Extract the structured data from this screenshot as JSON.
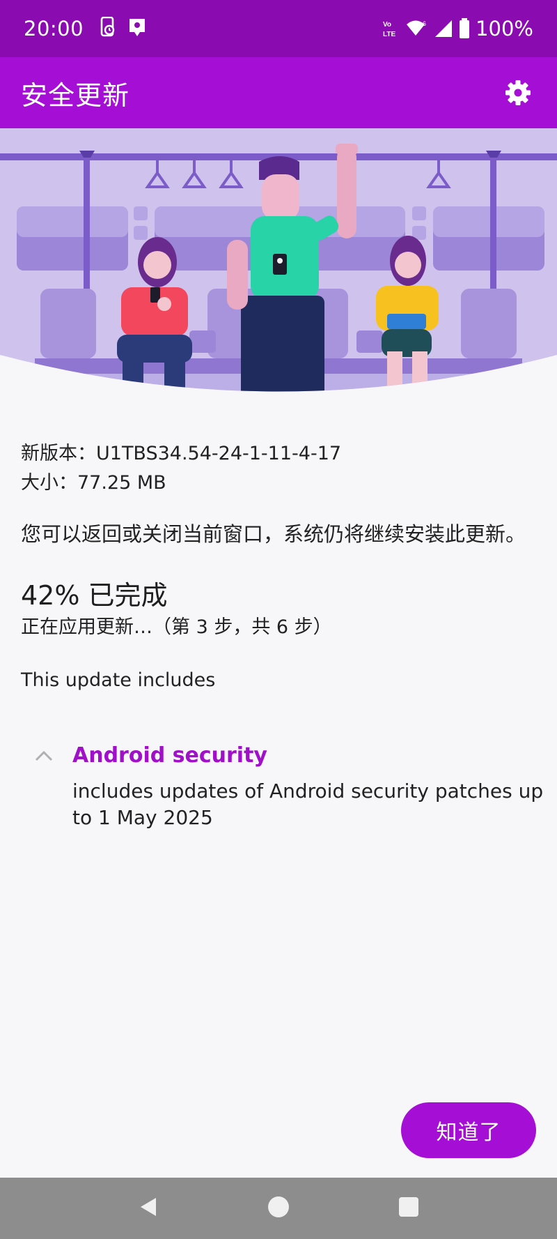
{
  "status_bar": {
    "time": "20:00",
    "battery": "100%",
    "network_label": "Vo LTE",
    "icons": [
      "screen-recorder-icon",
      "location-app-icon",
      "volte-icon",
      "wifi-icon",
      "signal-icon",
      "battery-icon"
    ]
  },
  "app_bar": {
    "title": "安全更新",
    "settings_icon": "gear-icon"
  },
  "info": {
    "version": "新版本：U1TBS34.54-24-1-11-4-17",
    "size": "大小：77.25 MB",
    "description": "您可以返回或关闭当前窗口，系统仍将继续安装此更新。"
  },
  "progress": {
    "percent": 42,
    "title": "42% 已完成",
    "step": "正在应用更新…（第 3 步，共 6 步）"
  },
  "includes": {
    "heading": "This update includes",
    "sections": [
      {
        "title": "Android security",
        "body": "includes updates of Android security patches up to 1 May 2025",
        "expanded": true
      }
    ]
  },
  "actions": {
    "ok_label": "知道了"
  },
  "navigation": {
    "icons": [
      "back-icon",
      "home-icon",
      "recents-icon"
    ]
  },
  "colors": {
    "status_bar": "#8a0bb0",
    "app_bar": "#a50ed5",
    "accent": "#a010c8",
    "background": "#f7f6f8",
    "nav_bar": "#8d8d8d"
  }
}
